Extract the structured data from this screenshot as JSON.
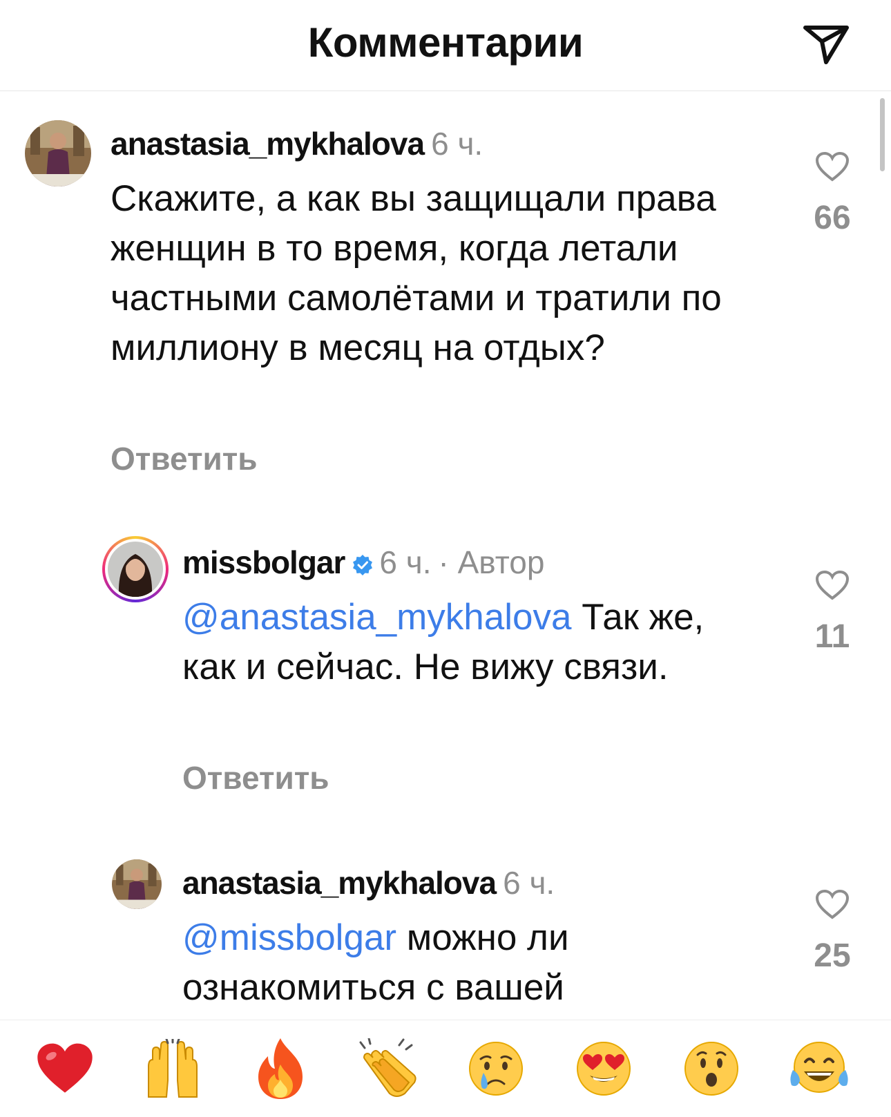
{
  "header": {
    "title": "Комментарии",
    "share_icon": "paper-plane-icon"
  },
  "comments": [
    {
      "username": "anastasia_mykhalova",
      "time": "6 ч.",
      "text": "Скажите, а как вы защищали права женщин в то время, когда летали частными самолётами и тратили по миллиону в месяц на отдых?",
      "reply_label": "Ответить",
      "likes": "66"
    },
    {
      "username": "missbolgar",
      "verified": true,
      "time": "6 ч.",
      "author_label": "· Автор",
      "mention": "@anastasia_mykhalova",
      "text": "Так же, как и сейчас. Не вижу связи.",
      "reply_label": "Ответить",
      "likes": "11"
    },
    {
      "username": "anastasia_mykhalova",
      "time": "6 ч.",
      "mention": "@missbolgar",
      "text": "можно ли ознакомиться с вашей",
      "likes": "25"
    }
  ],
  "reactions": [
    "❤️",
    "🙌",
    "🔥",
    "👏",
    "😢",
    "😍",
    "😮",
    "😂"
  ],
  "colors": {
    "mention": "#3d7de8",
    "muted": "#8e8e8e",
    "verified": "#3897f0"
  }
}
